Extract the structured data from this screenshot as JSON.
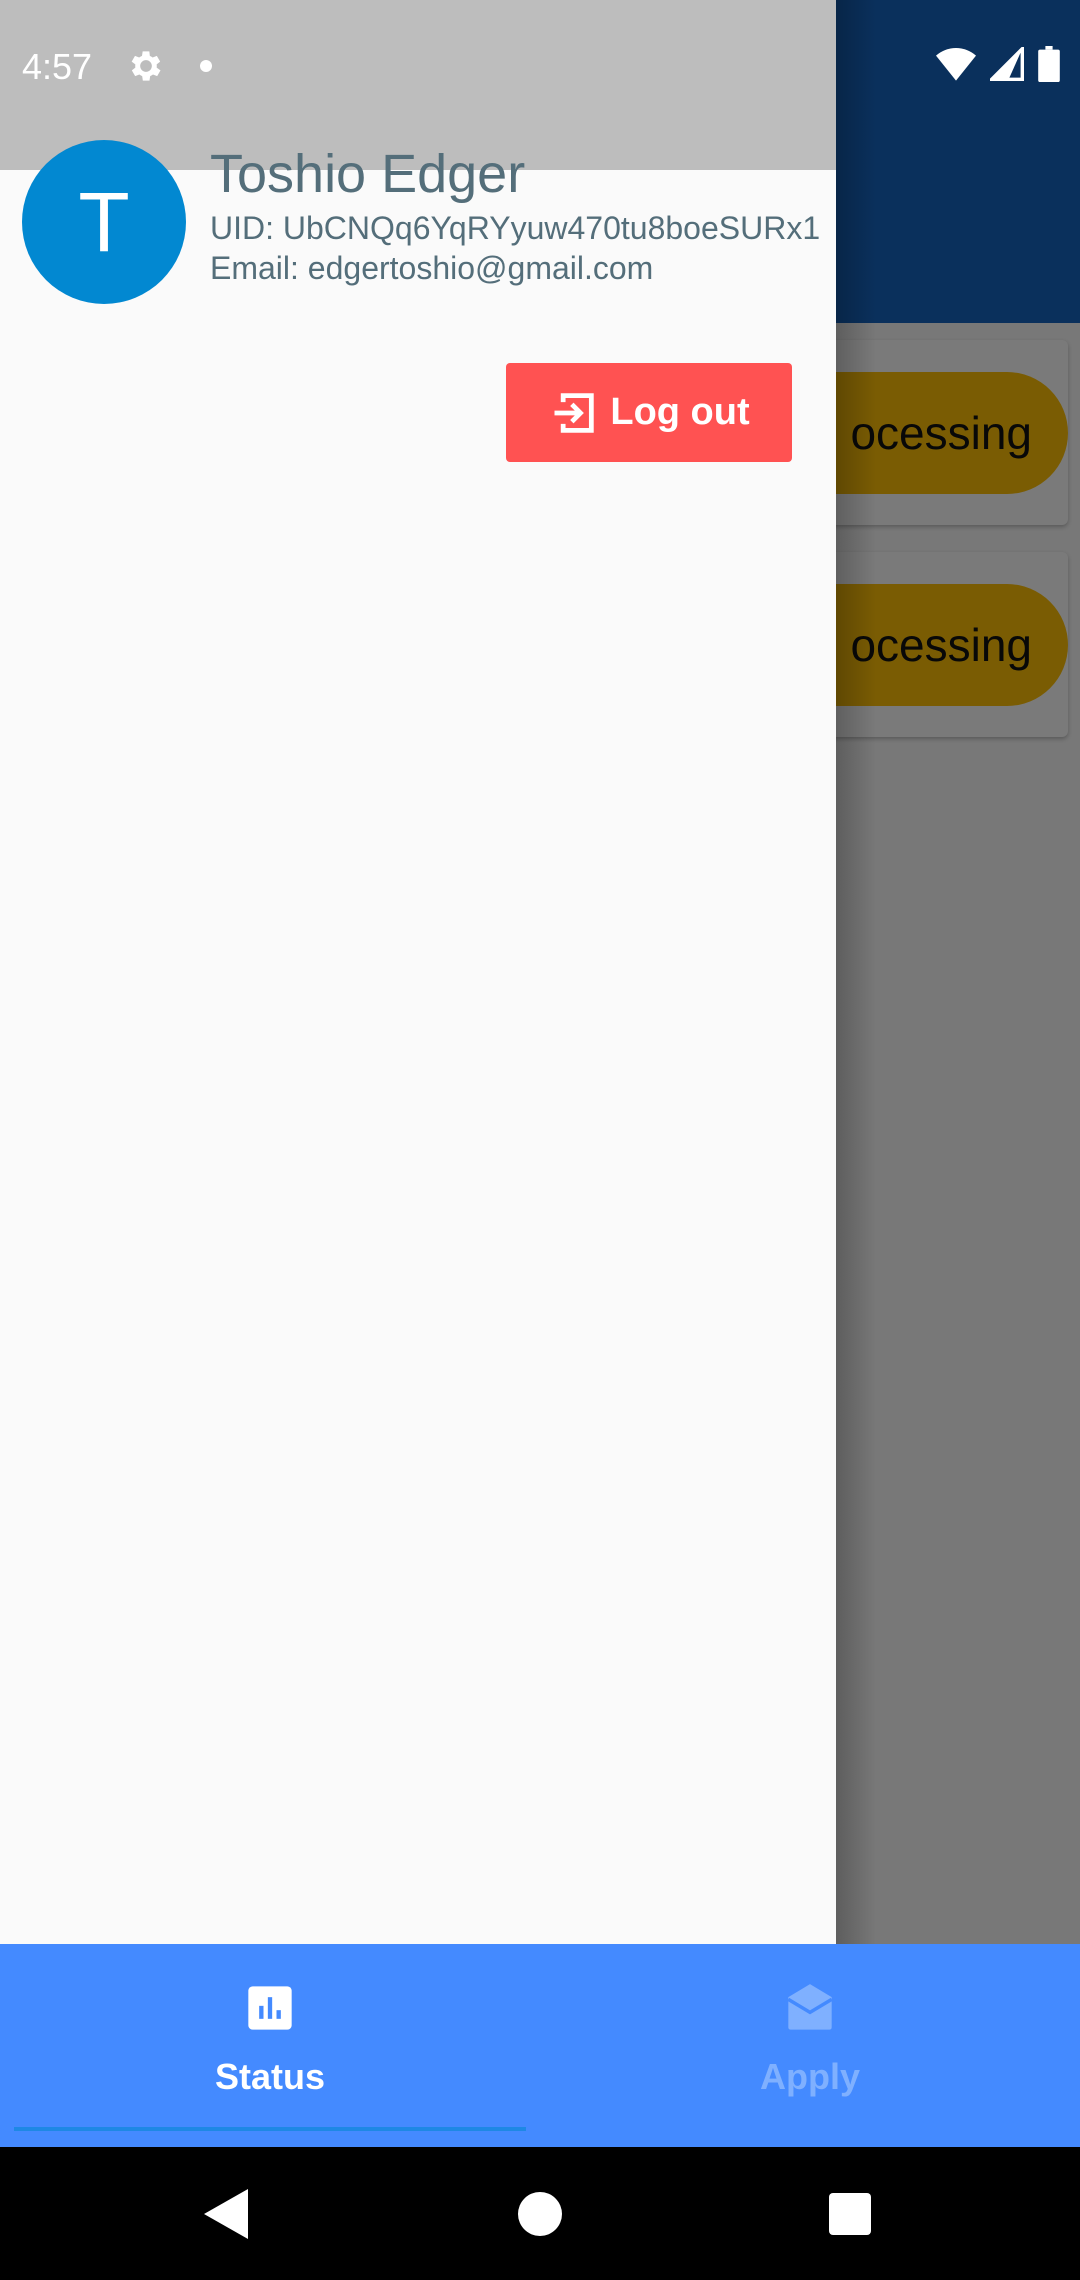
{
  "status_bar": {
    "time": "4:57",
    "icons": [
      "gear-icon",
      "notification-dot",
      "wifi-icon",
      "signal-icon",
      "battery-icon"
    ]
  },
  "background": {
    "cards": [
      {
        "status": "Processing",
        "visible_text": "ocessing",
        "status_color": "#ffc107"
      },
      {
        "status": "Processing",
        "visible_text": "ocessing",
        "status_color": "#ffc107"
      }
    ],
    "appbar_color": "#1565c0"
  },
  "drawer": {
    "avatar_letter": "T",
    "avatar_color": "#0288d1",
    "name": "Toshio Edger",
    "uid": "UID: UbCNQq6YqRYyuw470tu8boeSURx1",
    "email": "Email: edgertoshio@gmail.com",
    "logout_label": "Log out",
    "logout_icon": "logout-icon",
    "logout_color": "#ff5252"
  },
  "bottom_nav": {
    "color": "#448aff",
    "tabs": [
      {
        "label": "Status",
        "icon": "bar-chart-icon",
        "selected": true
      },
      {
        "label": "Apply",
        "icon": "mail-open-icon",
        "selected": false
      }
    ]
  },
  "system_nav": {
    "buttons": [
      "back-icon",
      "home-icon",
      "recents-icon"
    ]
  }
}
